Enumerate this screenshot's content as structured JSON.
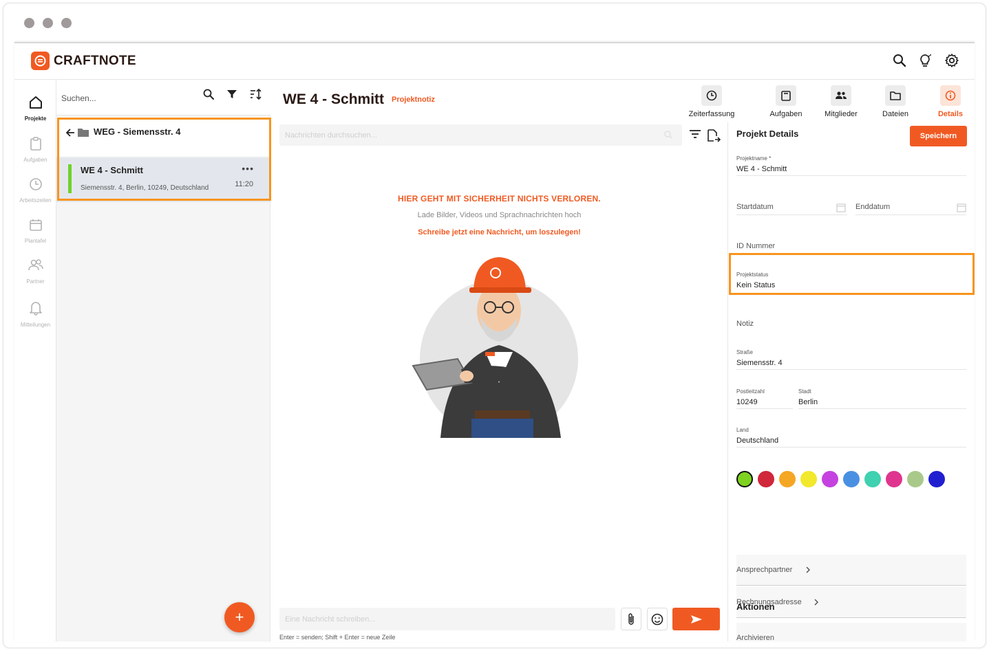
{
  "app": {
    "name": "CRAFTNOTE"
  },
  "sidenav": [
    {
      "label": "Projekte",
      "icon": "home-icon"
    },
    {
      "label": "Aufgaben",
      "icon": "clipboard-icon"
    },
    {
      "label": "Arbeitszeiten",
      "icon": "clock-icon"
    },
    {
      "label": "Plantafel",
      "icon": "calendar-icon"
    },
    {
      "label": "Partner",
      "icon": "users-icon"
    },
    {
      "label": "Mitteilungen",
      "icon": "bell-icon"
    }
  ],
  "list": {
    "search_placeholder": "Suchen...",
    "folder_title": "WEG - Siemensstr. 4",
    "project": {
      "name": "WE 4 - Schmitt",
      "address": "Siemensstr. 4, Berlin, 10249, Deutschland",
      "time": "11:20",
      "color": "#6fd22b"
    },
    "fab_label": "+"
  },
  "main": {
    "title": "WE 4 - Schmitt",
    "subtitle": "Projektnotiz",
    "tabs": [
      {
        "label": "Zeiterfassung",
        "icon": "clock-icon"
      },
      {
        "label": "Aufgaben",
        "icon": "clipboard-icon"
      },
      {
        "label": "Mitglieder",
        "icon": "members-icon"
      },
      {
        "label": "Dateien",
        "icon": "folder-icon"
      },
      {
        "label": "Details",
        "icon": "info-icon"
      }
    ],
    "message_search_placeholder": "Nachrichten durchsuchen...",
    "empty_heading": "HIER GEHT MIT SICHERHEIT NICHTS VERLOREN.",
    "empty_sub": "Lade Bilder, Videos und Sprachnachrichten hoch",
    "empty_cta": "Schreibe jetzt eine Nachricht, um loszulegen!",
    "compose_placeholder": "Eine Nachricht schreiben...",
    "compose_hint": "Enter = senden; Shift + Enter = neue Zeile"
  },
  "details": {
    "title": "Projekt Details",
    "save_label": "Speichern",
    "projektname_label": "Projektname *",
    "projektname_value": "WE 4 - Schmitt",
    "startdatum_placeholder": "Startdatum",
    "enddatum_placeholder": "Enddatum",
    "id_placeholder": "ID Nummer",
    "status_label": "Projektstatus",
    "status_value": "Kein Status",
    "notiz_placeholder": "Notiz",
    "strasse_label": "Straße",
    "strasse_value": "Siemensstr. 4",
    "plz_label": "Postleitzahl",
    "plz_value": "10249",
    "stadt_label": "Stadt",
    "stadt_value": "Berlin",
    "land_label": "Land",
    "land_value": "Deutschland",
    "colors": [
      "#7ed321",
      "#d0273a",
      "#f5a623",
      "#f2e82c",
      "#c542e0",
      "#4a90e2",
      "#3fd1b0",
      "#e0358f",
      "#a9c98a",
      "#2020d0"
    ],
    "ansprechpartner_label": "Ansprechpartner",
    "rechnungsadresse_label": "Rechnungsadresse",
    "aktionen_title": "Aktionen",
    "archivieren_label": "Archivieren"
  }
}
